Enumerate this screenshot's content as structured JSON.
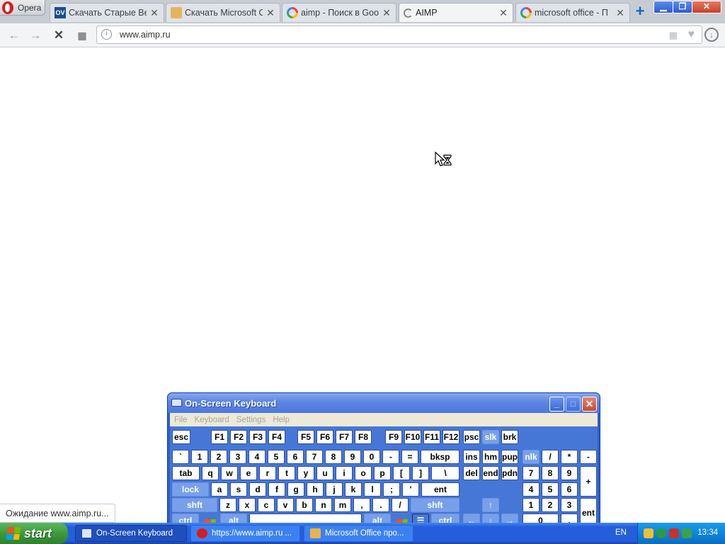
{
  "browser": {
    "menu_label": "Opera",
    "tabs": [
      {
        "title": "Скачать Старые Ве",
        "icon": "ov-favicon"
      },
      {
        "title": "Скачать Microsoft O",
        "icon": "folder-favicon"
      },
      {
        "title": "aimp - Поиск в Goo",
        "icon": "google-favicon"
      },
      {
        "title": "AIMP",
        "icon": "loading-spinner",
        "active": true
      },
      {
        "title": "microsoft office - П",
        "icon": "google-favicon"
      }
    ],
    "new_tab": "+",
    "url": "www.aimp.ru",
    "status_text": "Ожидание www.aimp.ru..."
  },
  "osk": {
    "title": "On-Screen Keyboard",
    "menu": [
      "File",
      "Keyboard",
      "Settings",
      "Help"
    ],
    "keys": {
      "esc": "esc",
      "f": [
        "F1",
        "F2",
        "F3",
        "F4",
        "F5",
        "F6",
        "F7",
        "F8",
        "F9",
        "F10",
        "F11",
        "F12"
      ],
      "psc": "psc",
      "slk": "slk",
      "brk": "brk",
      "row1": [
        "`",
        "1",
        "2",
        "3",
        "4",
        "5",
        "6",
        "7",
        "8",
        "9",
        "0",
        "-",
        "="
      ],
      "bksp": "bksp",
      "tab": "tab",
      "row2": [
        "q",
        "w",
        "e",
        "r",
        "t",
        "y",
        "u",
        "i",
        "o",
        "p",
        "[",
        "]",
        "\\"
      ],
      "lock": "lock",
      "row3": [
        "a",
        "s",
        "d",
        "f",
        "g",
        "h",
        "j",
        "k",
        "l",
        ";",
        "'"
      ],
      "ent": "ent",
      "shft": "shft",
      "row4": [
        "z",
        "x",
        "c",
        "v",
        "b",
        "n",
        "m",
        ",",
        ".",
        "/"
      ],
      "ctrl": "ctrl",
      "alt": "alt",
      "nav1": [
        "ins",
        "hm",
        "pup"
      ],
      "nav2": [
        "del",
        "end",
        "pdn"
      ],
      "num1": [
        "nlk",
        "/",
        "*",
        "-"
      ],
      "num2": [
        "7",
        "8",
        "9"
      ],
      "num3": [
        "4",
        "5",
        "6"
      ],
      "num4": [
        "1",
        "2",
        "3"
      ],
      "num_plus": "+",
      "num_0": "0",
      "num_dot": ".",
      "num_ent": "ent"
    }
  },
  "taskbar": {
    "start": "start",
    "tasks": [
      "On-Screen Keyboard",
      "https://www.aimp.ru ...",
      "Microsoft Office про..."
    ],
    "lang": "EN",
    "clock": "13:34"
  }
}
